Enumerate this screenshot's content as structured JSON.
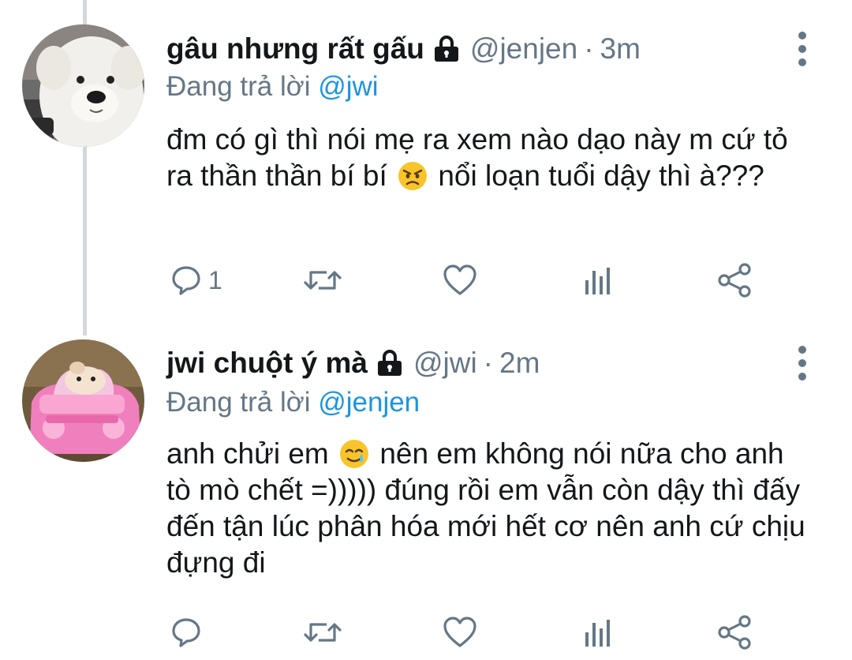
{
  "tweets": [
    {
      "name": "gâu nhưng rất gấu",
      "handle": "@jenjen",
      "separator": "·",
      "time": "3m",
      "reply_prefix": "Đang trả lời",
      "reply_to": "@jwi",
      "text_parts": [
        "đm có gì thì nói mẹ ra xem nào dạo này m cứ tỏ ra thần thần bí bí",
        "nổi loạn tuổi dậy thì à???"
      ],
      "emoji": "angry-face",
      "reply_count": "1",
      "avatar": "white-dog-avatar"
    },
    {
      "name": "jwi chuột ý mà",
      "handle": "@jwi",
      "separator": "·",
      "time": "2m",
      "reply_prefix": "Đang trả lời",
      "reply_to": "@jenjen",
      "text_parts": [
        "anh chửi em",
        "nên em không nói nữa cho anh tò mò chết =))))) đúng rồi em vẫn còn dậy thì đấy đến tận lúc phân hóa mới hết cơ nên anh cứ chịu đựng đi"
      ],
      "emoji": "smiling-face-with-tear",
      "reply_count": "",
      "avatar": "hamster-in-pink-car-avatar"
    }
  ],
  "icons": {
    "lock": "lock-icon",
    "reply": "reply-icon",
    "retweet": "retweet-icon",
    "like": "like-icon",
    "analytics": "analytics-icon",
    "share": "share-icon",
    "more": "more-icon"
  },
  "colors": {
    "text": "#14171a",
    "muted": "#657786",
    "link": "#1b95e0",
    "thread_line": "#d3d8dd"
  }
}
